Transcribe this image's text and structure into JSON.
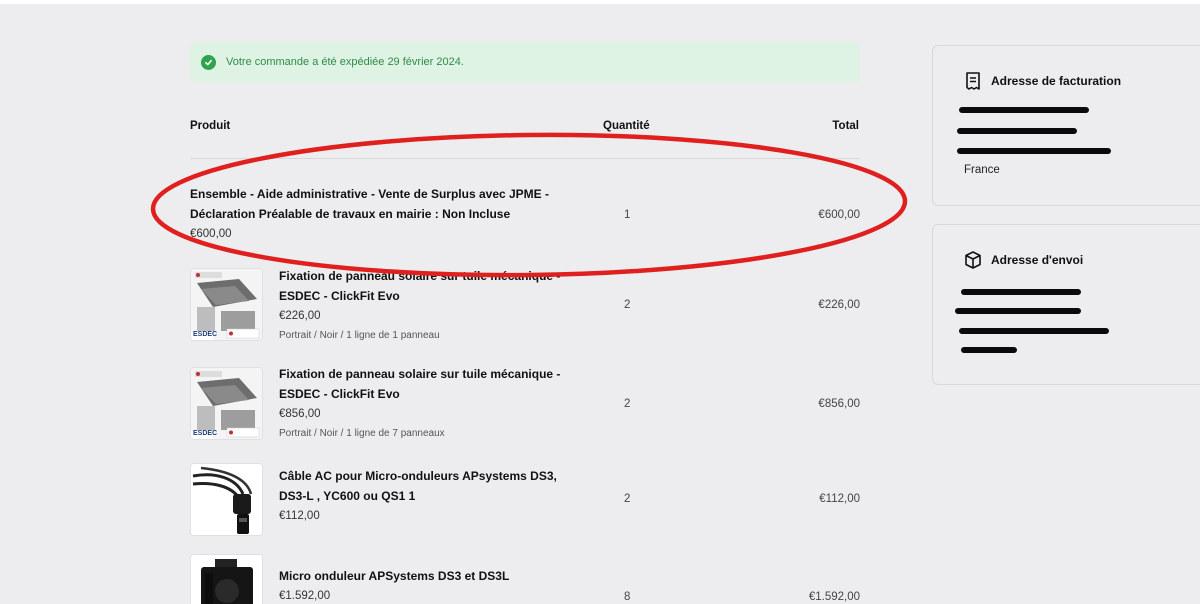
{
  "banner": {
    "message": "Votre commande a été expédiée 29 février 2024."
  },
  "table": {
    "headers": {
      "product": "Produit",
      "quantity": "Quantité",
      "total": "Total"
    }
  },
  "items": [
    {
      "name_line1": "Ensemble - Aide administrative - Vente de Surplus avec JPME -",
      "name_line2": "Déclaration Préalable de travaux en mairie : Non Incluse",
      "price": "€600,00",
      "quantity": "1",
      "total": "€600,00"
    },
    {
      "name_line1": "Fixation de panneau solaire sur tuile mécanique -",
      "name_line2": "ESDEC - ClickFit Evo",
      "price": "€226,00",
      "variant": "Portrait / Noir / 1 ligne de 1 panneau",
      "quantity": "2",
      "total": "€226,00",
      "thumb_brand": "ESDEC"
    },
    {
      "name_line1": "Fixation de panneau solaire sur tuile mécanique -",
      "name_line2": "ESDEC - ClickFit Evo",
      "price": "€856,00",
      "variant": "Portrait / Noir / 1 ligne de 7 panneaux",
      "quantity": "2",
      "total": "€856,00",
      "thumb_brand": "ESDEC"
    },
    {
      "name_line1": "Câble AC pour Micro-onduleurs APsystems DS3,",
      "name_line2": "DS3-L , YC600 ou QS1 1",
      "price": "€112,00",
      "quantity": "2",
      "total": "€112,00"
    },
    {
      "name_line1": "Micro onduleur APSystems DS3 et DS3L",
      "price": "€1.592,00",
      "quantity": "8",
      "total": "€1.592,00"
    }
  ],
  "billing": {
    "title": "Adresse de facturation",
    "country": "France"
  },
  "shipping": {
    "title": "Adresse d'envoi"
  },
  "colors": {
    "success": "#2ea44f",
    "annotation": "#e0201f",
    "redaction": "#0b0b0b"
  },
  "icons": {
    "success": "check-circle-icon",
    "billing": "receipt-icon",
    "shipping": "package-icon"
  }
}
